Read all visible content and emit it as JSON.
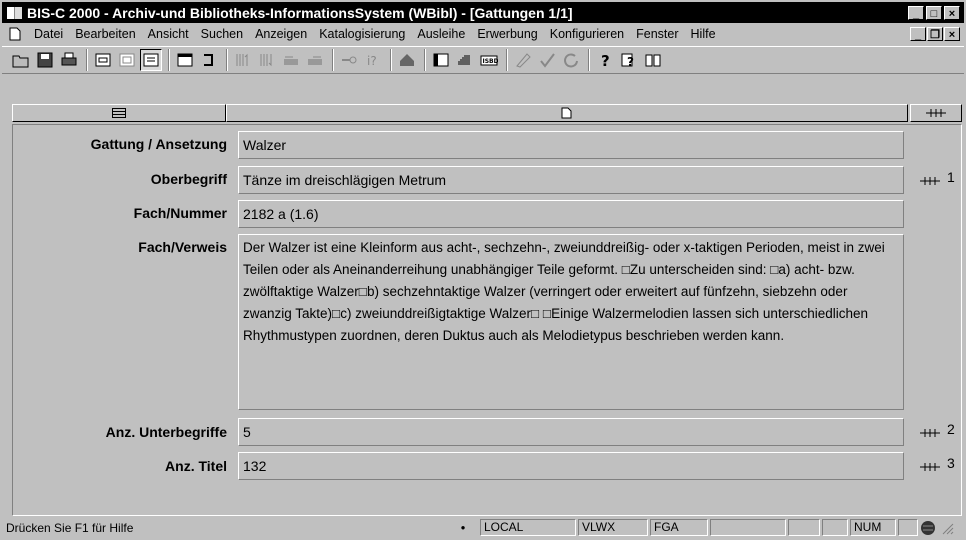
{
  "window": {
    "title": "BIS-C 2000 - Archiv-und Bibliotheks-InformationsSystem (WBibl) - [Gattungen 1/1]",
    "caption_buttons": [
      "minimize-icon",
      "maximize-icon",
      "close-icon"
    ]
  },
  "menu": {
    "items": [
      "Datei",
      "Bearbeiten",
      "Ansicht",
      "Suchen",
      "Anzeigen",
      "Katalogisierung",
      "Ausleihe",
      "Erwerbung",
      "Konfigurieren",
      "Fenster",
      "Hilfe"
    ]
  },
  "toolbar": {
    "icons": [
      "open-icon",
      "save-icon",
      "print-icon",
      "view-form-icon",
      "view-list-icon",
      "view-detail-icon",
      "window-icon",
      "undo-icon",
      "sort-asc-icon",
      "sort-desc-icon",
      "prev-record-icon",
      "next-record-icon",
      "key-icon",
      "query-icon",
      "home-icon",
      "table-icon",
      "barcode-icon",
      "isbd-icon",
      "eraser-icon",
      "check-icon",
      "refresh-icon",
      "help-icon",
      "context-help-icon",
      "book-icon"
    ]
  },
  "fields": [
    {
      "label": "Gattung / Ansetzung",
      "value": "Walzer",
      "link": ""
    },
    {
      "label": "Oberbegriff",
      "value": "Tänze im dreischlägigen Metrum",
      "link": "1"
    },
    {
      "label": "Fach/Nummer",
      "value": "2182 a (1.6)",
      "link": ""
    },
    {
      "label": "Fach/Verweis",
      "value": "Der Walzer ist eine Kleinform aus acht-, sechzehn-, zweiunddreißig- oder x-taktigen Perioden, meist in zwei Teilen oder als Aneinanderreihung unabhängiger Teile geformt. □Zu unterscheiden sind: □a) acht- bzw. zwölftaktige Walzer□b) sechzehntaktige Walzer (verringert oder erweitert auf fünfzehn, siebzehn oder zwanzig Takte)□c) zweiunddreißigtaktige Walzer□ □Einige Walzermelodien lassen sich unterschiedlichen Rhythmustypen zuordnen, deren Duktus auch als Melodietypus beschrieben werden kann.",
      "link": ""
    },
    {
      "label": "Anz. Unterbegriffe",
      "value": "5",
      "link": "2"
    },
    {
      "label": "Anz. Titel",
      "value": "132",
      "link": "3"
    }
  ],
  "status": {
    "help": "Drücken Sie F1 für Hilfe",
    "panes": [
      "LOCAL",
      "VLWX",
      "FGA",
      "",
      "",
      "",
      "NUM",
      ""
    ]
  }
}
